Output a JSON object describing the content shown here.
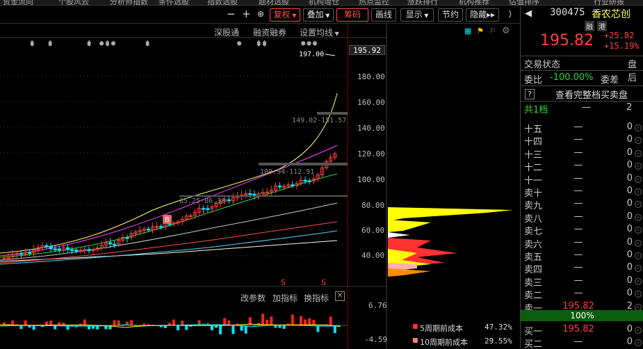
{
  "top_menu": [
    "资金流向",
    "个股风云",
    "分析师指数",
    "条件选股",
    "指数选股",
    "题材选股",
    "机构增仓",
    "热点监控",
    "涨跌排行",
    "机构推荐",
    "估值排序",
    "行业研报"
  ],
  "toolbar": {
    "fuquan": "复权",
    "diejia": "叠加",
    "chouma": "筹码",
    "huaxian": "画线",
    "xianshi": "显示",
    "jieyue": "节约",
    "yincang": "隐藏"
  },
  "subbar": {
    "link1": "深股通",
    "link2": "融资融券",
    "link3": "设置均线"
  },
  "price_axis": [
    "195.92",
    "180.00",
    "160.00",
    "140.00",
    "120.00",
    "100.00",
    "80.00",
    "60.00",
    "40.00"
  ],
  "annotations": {
    "high": "197.00",
    "box1": "149.02-151.57",
    "box2": "109.94-112.91",
    "box3": "85.25-86.38",
    "b_marker": "B",
    "s_marker": "S"
  },
  "indicator": {
    "params": "改参数",
    "add": "加指标",
    "change": "换指标",
    "top_value": "6.76",
    "bottom_value": "-4.59"
  },
  "cost": {
    "row1_label": "5周期前成本",
    "row1_value": "47.32%",
    "row2_label": "10周期前成本",
    "row2_value": "29.55%"
  },
  "quote": {
    "code": "300475",
    "name": "香农芯创",
    "tag1": "融",
    "tag2": "港",
    "price": "195.82",
    "change": "+25.82",
    "change_pct": "+15.19%",
    "status_label": "交易状态",
    "status_value": "盘后",
    "weibi_label": "委比",
    "weibi_value": "-100.00%",
    "weicha_label": "委差",
    "help": "?",
    "view_full": "查看完整档买卖盘",
    "total_label": "共1档",
    "total_dash": "—",
    "total_value": "2",
    "percent_bar": "100%"
  },
  "order_book": [
    {
      "label": "十五",
      "price": "—",
      "vol": "0"
    },
    {
      "label": "十四",
      "price": "—",
      "vol": "0"
    },
    {
      "label": "十三",
      "price": "—",
      "vol": "0"
    },
    {
      "label": "十二",
      "price": "—",
      "vol": "0"
    },
    {
      "label": "十一",
      "price": "—",
      "vol": "0"
    },
    {
      "label": "卖十",
      "price": "—",
      "vol": "0"
    },
    {
      "label": "卖九",
      "price": "—",
      "vol": "0"
    },
    {
      "label": "卖八",
      "price": "—",
      "vol": "0"
    },
    {
      "label": "卖七",
      "price": "—",
      "vol": "0"
    },
    {
      "label": "卖六",
      "price": "—",
      "vol": "0"
    },
    {
      "label": "卖五",
      "price": "—",
      "vol": "0"
    },
    {
      "label": "卖四",
      "price": "—",
      "vol": "0"
    },
    {
      "label": "卖三",
      "price": "—",
      "vol": "0"
    },
    {
      "label": "卖二",
      "price": "—",
      "vol": "0"
    },
    {
      "label": "卖一",
      "price": "195.82",
      "vol": "2"
    }
  ],
  "buy_book": [
    {
      "label": "买一",
      "price": "195.82",
      "vol": "0"
    },
    {
      "label": "买二",
      "price": "—",
      "vol": "0"
    }
  ],
  "colors": {
    "up": "#ff4040",
    "down": "#2ddc2d",
    "cyan": "#00e5ff",
    "yellow": "#ffff00"
  }
}
